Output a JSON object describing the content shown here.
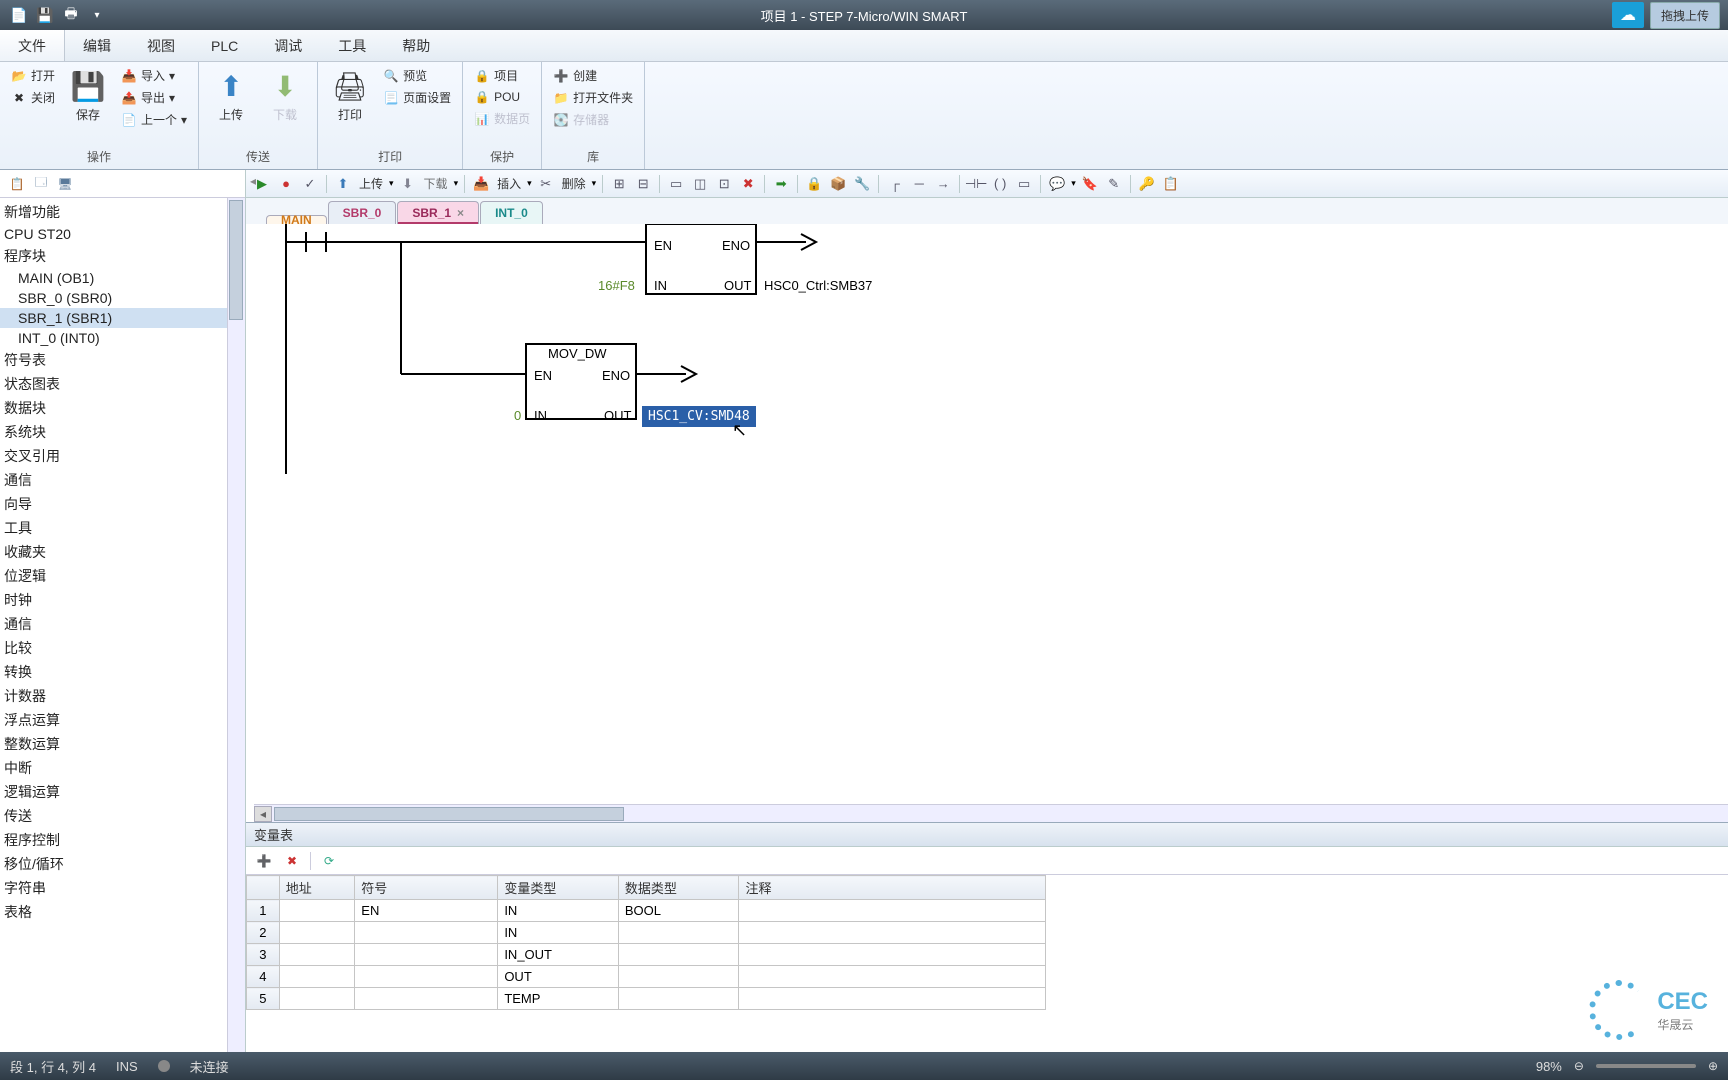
{
  "title": "项目 1 - STEP 7-Micro/WIN SMART",
  "drag_upload": "拖拽上传",
  "menu": {
    "file": "文件",
    "edit": "编辑",
    "view": "视图",
    "plc": "PLC",
    "debug": "调试",
    "tool": "工具",
    "help": "帮助"
  },
  "ribbon": {
    "ops": {
      "open": "打开",
      "close": "关闭",
      "save": "保存",
      "import": "导入",
      "export": "导出",
      "prev": "上一个",
      "label": "操作"
    },
    "transfer": {
      "upload": "上传",
      "download": "下载",
      "label": "传送"
    },
    "print": {
      "print": "打印",
      "preview": "预览",
      "pagesetup": "页面设置",
      "label": "打印"
    },
    "protect": {
      "project": "项目",
      "pou": "POU",
      "datapage": "数据页",
      "label": "保护"
    },
    "lib": {
      "create": "创建",
      "openfolder": "打开文件夹",
      "memory": "存储器",
      "label": "库"
    }
  },
  "tree": {
    "items": [
      "新增功能",
      "CPU ST20",
      "程序块",
      "MAIN (OB1)",
      "SBR_0 (SBR0)",
      "SBR_1 (SBR1)",
      "INT_0 (INT0)",
      "符号表",
      "状态图表",
      "数据块",
      "系统块",
      "交叉引用",
      "通信",
      "向导",
      "工具",
      "收藏夹",
      "位逻辑",
      "时钟",
      "通信",
      "比较",
      "转换",
      "计数器",
      "浮点运算",
      "整数运算",
      "中断",
      "逻辑运算",
      "传送",
      "程序控制",
      "移位/循环",
      "字符串",
      "表格"
    ]
  },
  "editor_toolbar": {
    "upload": "上传",
    "download": "下载",
    "insert": "插入",
    "delete": "删除"
  },
  "tabs": {
    "main": "MAIN",
    "sbr0": "SBR_0",
    "sbr1": "SBR_1",
    "int0": "INT_0"
  },
  "ladder": {
    "block1": {
      "en": "EN",
      "eno": "ENO",
      "in": "IN",
      "out": "OUT",
      "in_val": "16#F8",
      "out_val": "HSC0_Ctrl:SMB37"
    },
    "block2": {
      "title": "MOV_DW",
      "en": "EN",
      "eno": "ENO",
      "in": "IN",
      "out": "OUT",
      "in_val": "0",
      "out_val": "HSC1_CV:SMD48"
    }
  },
  "var_panel": {
    "title": "变量表",
    "headers": {
      "addr": "地址",
      "symbol": "符号",
      "vartype": "变量类型",
      "datatype": "数据类型",
      "comment": "注释"
    },
    "rows": [
      {
        "n": "1",
        "addr": "",
        "symbol": "EN",
        "vartype": "IN",
        "datatype": "BOOL",
        "comment": ""
      },
      {
        "n": "2",
        "addr": "",
        "symbol": "",
        "vartype": "IN",
        "datatype": "",
        "comment": ""
      },
      {
        "n": "3",
        "addr": "",
        "symbol": "",
        "vartype": "IN_OUT",
        "datatype": "",
        "comment": ""
      },
      {
        "n": "4",
        "addr": "",
        "symbol": "",
        "vartype": "OUT",
        "datatype": "",
        "comment": ""
      },
      {
        "n": "5",
        "addr": "",
        "symbol": "",
        "vartype": "TEMP",
        "datatype": "",
        "comment": ""
      }
    ]
  },
  "statusbar": {
    "pos": "段 1, 行 4, 列 4",
    "ins": "INS",
    "conn": "未连接",
    "zoom": "98%"
  },
  "logo": {
    "brand": "CEC",
    "sub": "华晟云"
  }
}
